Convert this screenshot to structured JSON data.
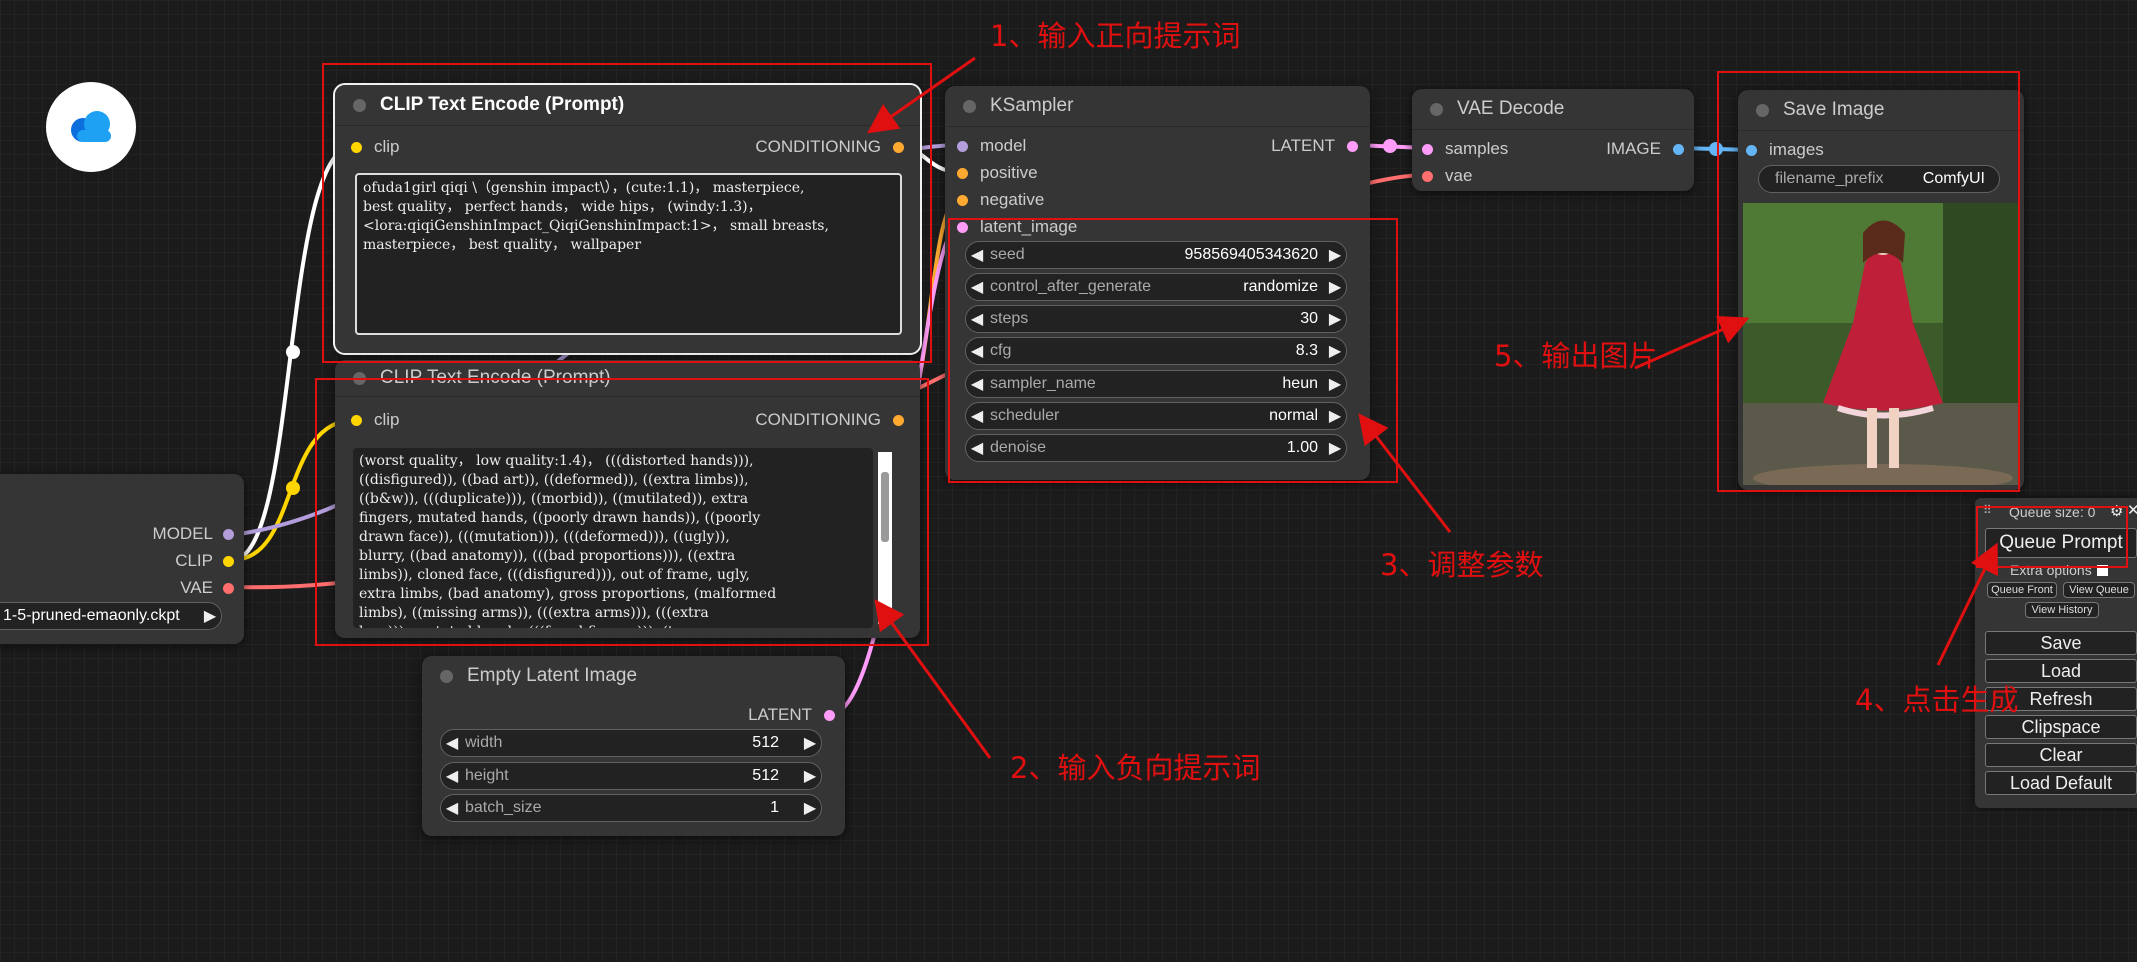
{
  "clip_pos": {
    "title": "CLIP Text Encode (Prompt)",
    "input": "clip",
    "output": "CONDITIONING",
    "text": "ofuda1girl qiqi \\（genshin impact\\），(cute:1.1)， masterpiece,\nbest quality， perfect hands， wide hips， (windy:1.3)，\n<lora:qiqiGenshinImpact_QiqiGenshinImpact:1>， small breasts,\nmasterpiece， best quality， wallpaper"
  },
  "clip_neg": {
    "title": "CLIP Text Encode (Prompt)",
    "input": "clip",
    "output": "CONDITIONING",
    "text": "(worst quality， low quality:1.4)， (((distorted hands))),\n((disfigured)), ((bad art)), ((deformed)), ((extra limbs)),\n((b&w)), (((duplicate))), ((morbid)), ((mutilated)), extra\nfingers, mutated hands, ((poorly drawn hands)), ((poorly\ndrawn face)), (((mutation))), (((deformed))), ((ugly)),\nblurry, ((bad anatomy)), (((bad proportions))), ((extra\nlimbs)), cloned face, (((disfigured))), out of frame, ugly,\nextra limbs, (bad anatomy), gross proportions, (malformed\nlimbs), ((missing arms)), (((extra arms))), (((extra\nlegs))), mutated hands, (((fused fingers))), (too many"
  },
  "checkpoint": {
    "outputs": [
      "MODEL",
      "CLIP",
      "VAE"
    ],
    "ckpt_name": "1-5-pruned-emaonly.ckpt"
  },
  "ksampler": {
    "title": "KSampler",
    "inputs": [
      "model",
      "positive",
      "negative",
      "latent_image"
    ],
    "output": "LATENT",
    "widgets": [
      {
        "label": "seed",
        "value": "958569405343620"
      },
      {
        "label": "control_after_generate",
        "value": "randomize"
      },
      {
        "label": "steps",
        "value": "30"
      },
      {
        "label": "cfg",
        "value": "8.3"
      },
      {
        "label": "sampler_name",
        "value": "heun"
      },
      {
        "label": "scheduler",
        "value": "normal"
      },
      {
        "label": "denoise",
        "value": "1.00"
      }
    ]
  },
  "vae_decode": {
    "title": "VAE Decode",
    "inputs": [
      "samples",
      "vae"
    ],
    "output": "IMAGE"
  },
  "save_image": {
    "title": "Save Image",
    "input": "images",
    "prefix_label": "filename_prefix",
    "prefix_value": "ComfyUI"
  },
  "empty_latent": {
    "title": "Empty Latent Image",
    "output": "LATENT",
    "widgets": [
      {
        "label": "width",
        "value": "512"
      },
      {
        "label": "height",
        "value": "512"
      },
      {
        "label": "batch_size",
        "value": "1"
      }
    ]
  },
  "menu": {
    "queue_size": "Queue size: 0",
    "queue_prompt": "Queue Prompt",
    "extra_options": "Extra options",
    "queue_front": "Queue Front",
    "view_queue": "View Queue",
    "view_history": "View History",
    "buttons": [
      "Save",
      "Load",
      "Refresh",
      "Clipspace",
      "Clear",
      "Load Default"
    ]
  },
  "annotations": {
    "a1": "1、输入正向提示词",
    "a2": "2、输入负向提示词",
    "a3": "3、调整参数",
    "a4": "4、点击生成",
    "a5": "5、输出图片"
  },
  "colors": {
    "annotation_red": "#e01010",
    "clip": "#ffd500",
    "conditioning": "#ffa931",
    "model": "#b39ddb",
    "latent": "#ff9cf9",
    "vae": "#ff6e6e",
    "image": "#64b5f6"
  }
}
